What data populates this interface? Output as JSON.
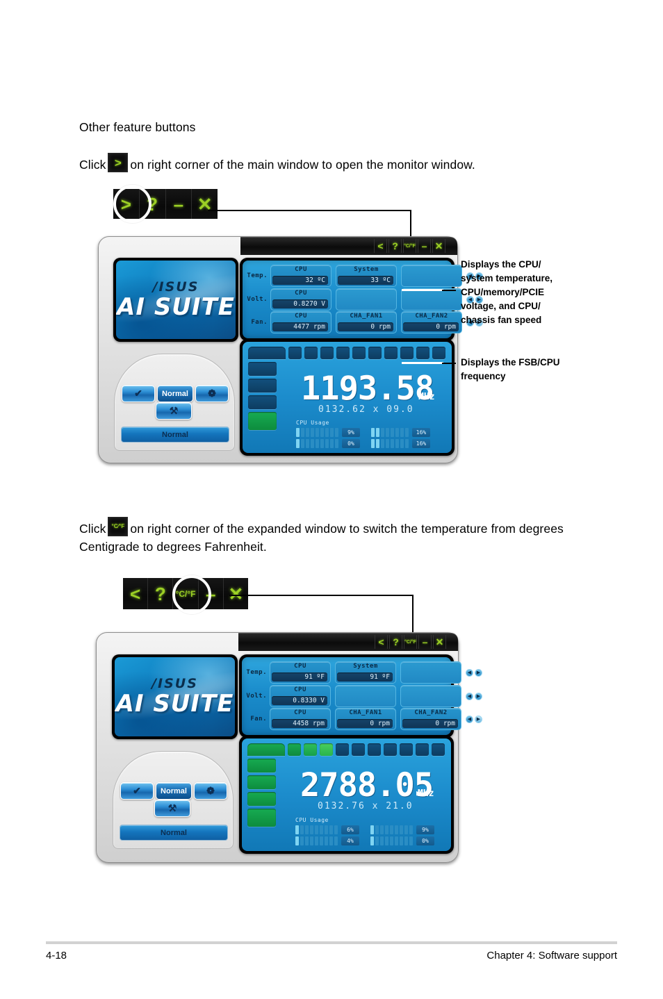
{
  "page": {
    "heading": "Other feature buttons",
    "para1_pre": "Click",
    "para1_post": "on right corner of the main window to open the monitor window.",
    "para2_pre": "Click",
    "para2_post": "on right corner of the expanded window to switch the temperature from degrees Centigrade to degrees Fahrenheit."
  },
  "footer": {
    "page_number": "4-18",
    "chapter": "Chapter 4: Software support"
  },
  "colors": {
    "toolbar_green": "#9ccf25",
    "toolbar_black": "#0a0a0a",
    "panel_blue": "#1a8ccb",
    "led_green": "#17ab52",
    "digit_white": "#ffffff"
  },
  "inline_icons": {
    "expand": ">",
    "temp_unit_top": "°C",
    "temp_unit_slash": "/",
    "temp_unit_bottom": "°F"
  },
  "toolstrip_1": {
    "buttons": [
      {
        "name": "expand-button",
        "label": ">"
      },
      {
        "name": "help-button",
        "label": "?"
      },
      {
        "name": "minimize-button",
        "label": "–"
      },
      {
        "name": "close-button",
        "label": "✕"
      }
    ],
    "highlighted": "expand-button"
  },
  "toolstrip_2": {
    "buttons": [
      {
        "name": "collapse-button",
        "label": "<"
      },
      {
        "name": "help-button",
        "label": "?"
      },
      {
        "name": "temp-unit-button",
        "label": "°C/°F"
      },
      {
        "name": "minimize-button",
        "label": "–"
      },
      {
        "name": "close-button",
        "label": "✕"
      }
    ],
    "highlighted": "temp-unit-button"
  },
  "callouts": [
    {
      "name": "callout-monitor-panel",
      "text": "Displays the CPU/ system temperature, CPU/memory/PCIE voltage, and CPU/ chassis fan speed"
    },
    {
      "name": "callout-frequency-panel",
      "text": "Displays the FSB/CPU frequency"
    }
  ],
  "app_window_1": {
    "titlebar": {
      "buttons": [
        "<",
        "?",
        "°C/°F",
        "–",
        "✕"
      ]
    },
    "logo": {
      "brand": "/ISUS",
      "product": "AI SUITE"
    },
    "controls": {
      "row_buttons": [
        {
          "name": "ai-nap-button",
          "label": "✔"
        },
        {
          "name": "ai-overclock-button",
          "label": "Normal"
        },
        {
          "name": "q-fan-button",
          "label": "❁"
        }
      ],
      "chip_button": {
        "name": "ai-gear-button",
        "label": "⚒"
      },
      "status_bar": "Normal"
    },
    "monitor": {
      "rows": [
        {
          "label": "Temp.",
          "cells": [
            {
              "caption": "CPU",
              "value": "32 ºC"
            },
            {
              "caption": "System",
              "value": "33 ºC"
            },
            {
              "caption": "",
              "value": ""
            }
          ]
        },
        {
          "label": "Volt.",
          "cells": [
            {
              "caption": "CPU",
              "value": "0.8270 V"
            },
            {
              "caption": "",
              "value": ""
            },
            {
              "caption": "",
              "value": ""
            }
          ]
        },
        {
          "label": "Fan.",
          "cells": [
            {
              "caption": "CPU",
              "value": "4477 rpm"
            },
            {
              "caption": "CHA_FAN1",
              "value": "0 rpm"
            },
            {
              "caption": "CHA_FAN2",
              "value": "0 rpm"
            }
          ]
        }
      ]
    },
    "frequency": {
      "value": "1193.58",
      "unit": "MHz",
      "detail": "0132.62 x 09.0",
      "usage_title": "CPU Usage",
      "usage": [
        {
          "name": "core0-usage",
          "percent": "9%",
          "lit": 1,
          "total": 10
        },
        {
          "name": "core1-usage",
          "percent": "16%",
          "lit": 2,
          "total": 10
        },
        {
          "name": "core2-usage",
          "percent": "0%",
          "lit": 1,
          "total": 10
        },
        {
          "name": "core3-usage",
          "percent": "16%",
          "lit": 2,
          "total": 10
        }
      ],
      "top_segments_on": 0,
      "top_segments_total": 11,
      "left_segments_on": 1,
      "left_segments_total": 5
    }
  },
  "app_window_2": {
    "titlebar": {
      "buttons": [
        "<",
        "?",
        "°C/°F",
        "–",
        "✕"
      ]
    },
    "logo": {
      "brand": "/ISUS",
      "product": "AI SUITE"
    },
    "controls": {
      "row_buttons": [
        {
          "name": "ai-nap-button",
          "label": "✔"
        },
        {
          "name": "ai-overclock-button",
          "label": "Normal"
        },
        {
          "name": "q-fan-button",
          "label": "❁"
        }
      ],
      "chip_button": {
        "name": "ai-gear-button",
        "label": "⚒"
      },
      "status_bar": "Normal"
    },
    "monitor": {
      "rows": [
        {
          "label": "Temp.",
          "cells": [
            {
              "caption": "CPU",
              "value": "91 ºF"
            },
            {
              "caption": "System",
              "value": "91 ºF"
            },
            {
              "caption": "",
              "value": ""
            }
          ]
        },
        {
          "label": "Volt.",
          "cells": [
            {
              "caption": "CPU",
              "value": "0.8330 V"
            },
            {
              "caption": "",
              "value": ""
            },
            {
              "caption": "",
              "value": ""
            }
          ]
        },
        {
          "label": "Fan.",
          "cells": [
            {
              "caption": "CPU",
              "value": "4458 rpm"
            },
            {
              "caption": "CHA_FAN1",
              "value": "0 rpm"
            },
            {
              "caption": "CHA_FAN2",
              "value": "0 rpm"
            }
          ]
        }
      ]
    },
    "frequency": {
      "value": "2788.05",
      "unit": "MHz",
      "detail": "0132.76 x 21.0",
      "usage_title": "CPU Usage",
      "usage": [
        {
          "name": "core0-usage",
          "percent": "6%",
          "lit": 1,
          "total": 10
        },
        {
          "name": "core1-usage",
          "percent": "9%",
          "lit": 1,
          "total": 10
        },
        {
          "name": "core2-usage",
          "percent": "4%",
          "lit": 1,
          "total": 10
        },
        {
          "name": "core3-usage",
          "percent": "0%",
          "lit": 1,
          "total": 10
        }
      ],
      "top_segments_on": 4,
      "top_segments_total": 11,
      "left_segments_on": 5,
      "left_segments_total": 5
    }
  }
}
